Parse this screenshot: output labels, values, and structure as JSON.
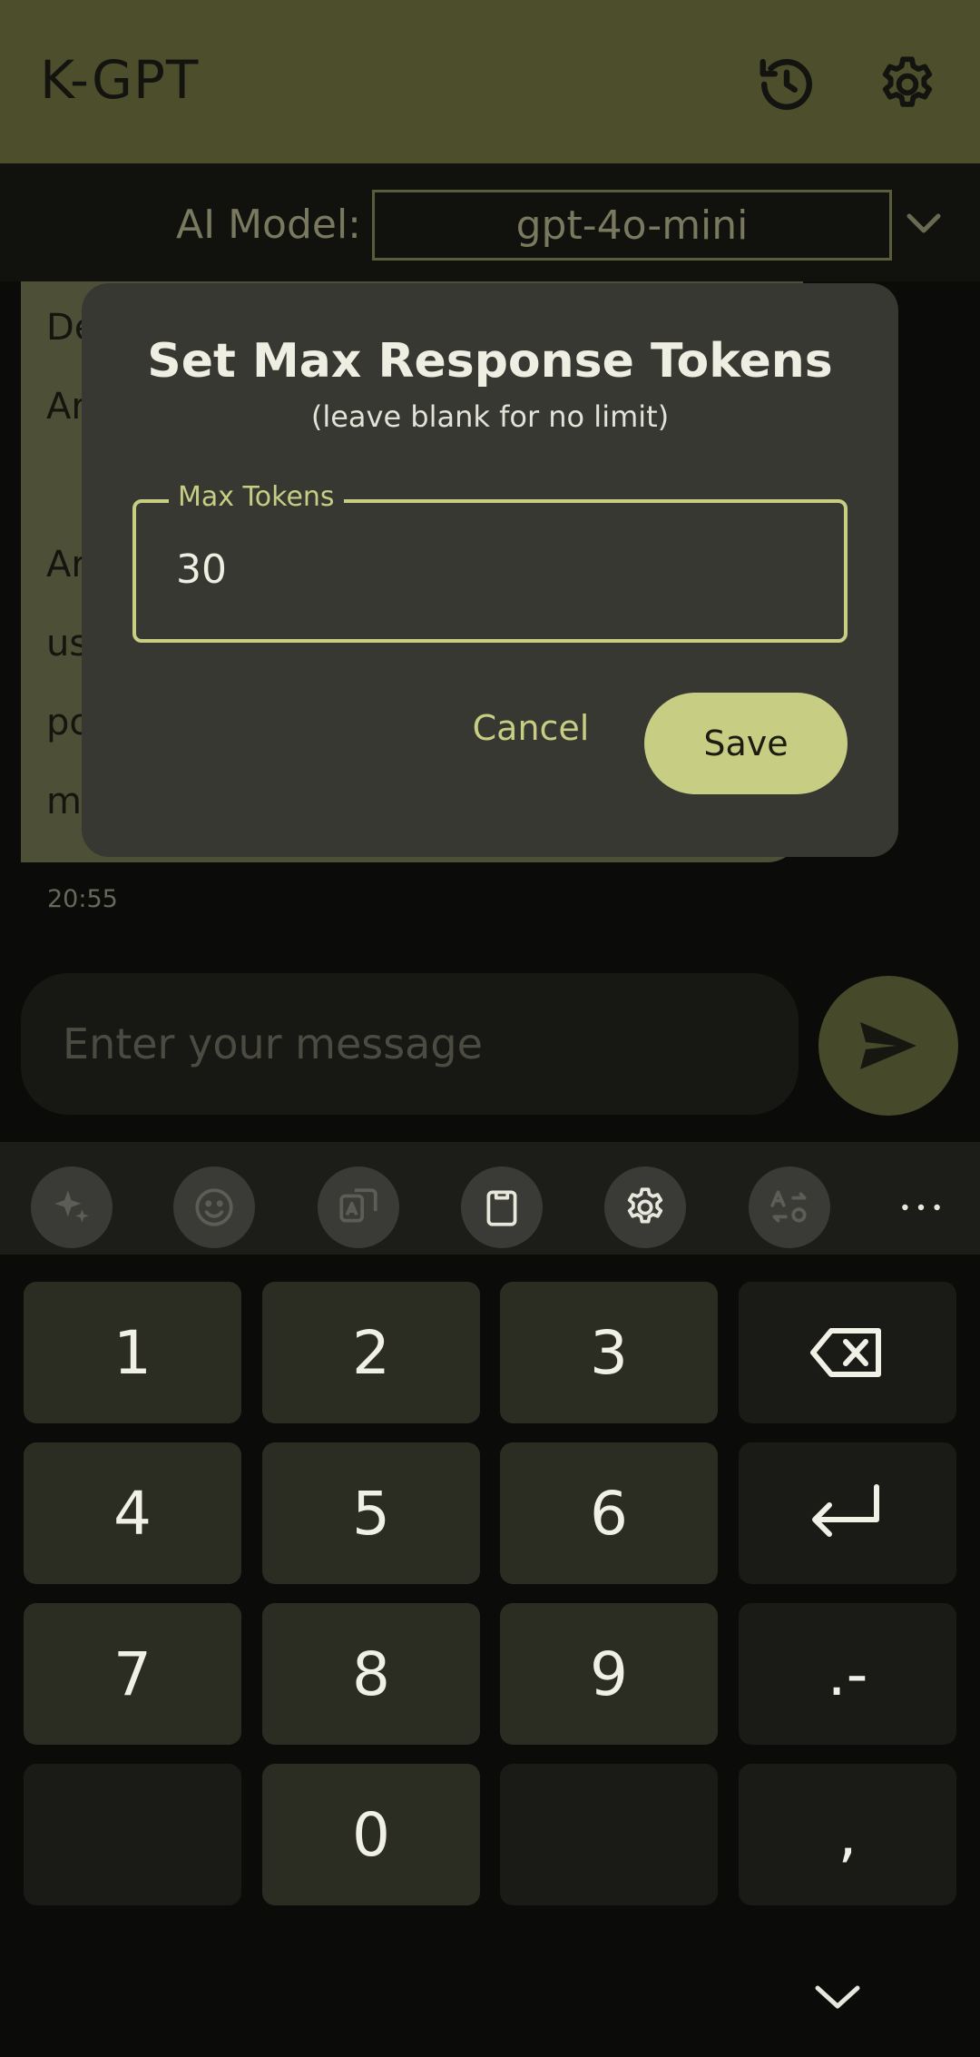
{
  "app": {
    "title": "K-GPT",
    "icons": {
      "history": "history-icon",
      "settings": "gear-icon"
    }
  },
  "model": {
    "label": "AI Model:",
    "selected": "gpt-4o-mini"
  },
  "chat": {
    "message_text": "De\nAr\n\nAr\nus\npo\nmo\ndi\nus",
    "timestamp": "20:55",
    "input_placeholder": "Enter your message"
  },
  "dialog": {
    "title": "Set Max Response Tokens",
    "subtitle": "(leave blank for no limit)",
    "field_label": "Max Tokens",
    "field_value": "30",
    "cancel_label": "Cancel",
    "save_label": "Save"
  },
  "keyboard": {
    "toolbar_icons": [
      "sparkle-icon",
      "emoji-icon",
      "translate-icon",
      "clipboard-icon",
      "gear-icon",
      "text-swap-icon",
      "more-icon"
    ],
    "keys": {
      "k1": "1",
      "k2": "2",
      "k3": "3",
      "k4": "4",
      "k5": "5",
      "k6": "6",
      "k7": "7",
      "k8": "8",
      "k9": "9",
      "k0": "0",
      "dot_dash": ".-",
      "comma": ","
    }
  },
  "colors": {
    "accent": "#c7ce84",
    "appbar": "#4d4f2c",
    "dialog_bg": "#383833",
    "background": "#0b0b0a"
  }
}
